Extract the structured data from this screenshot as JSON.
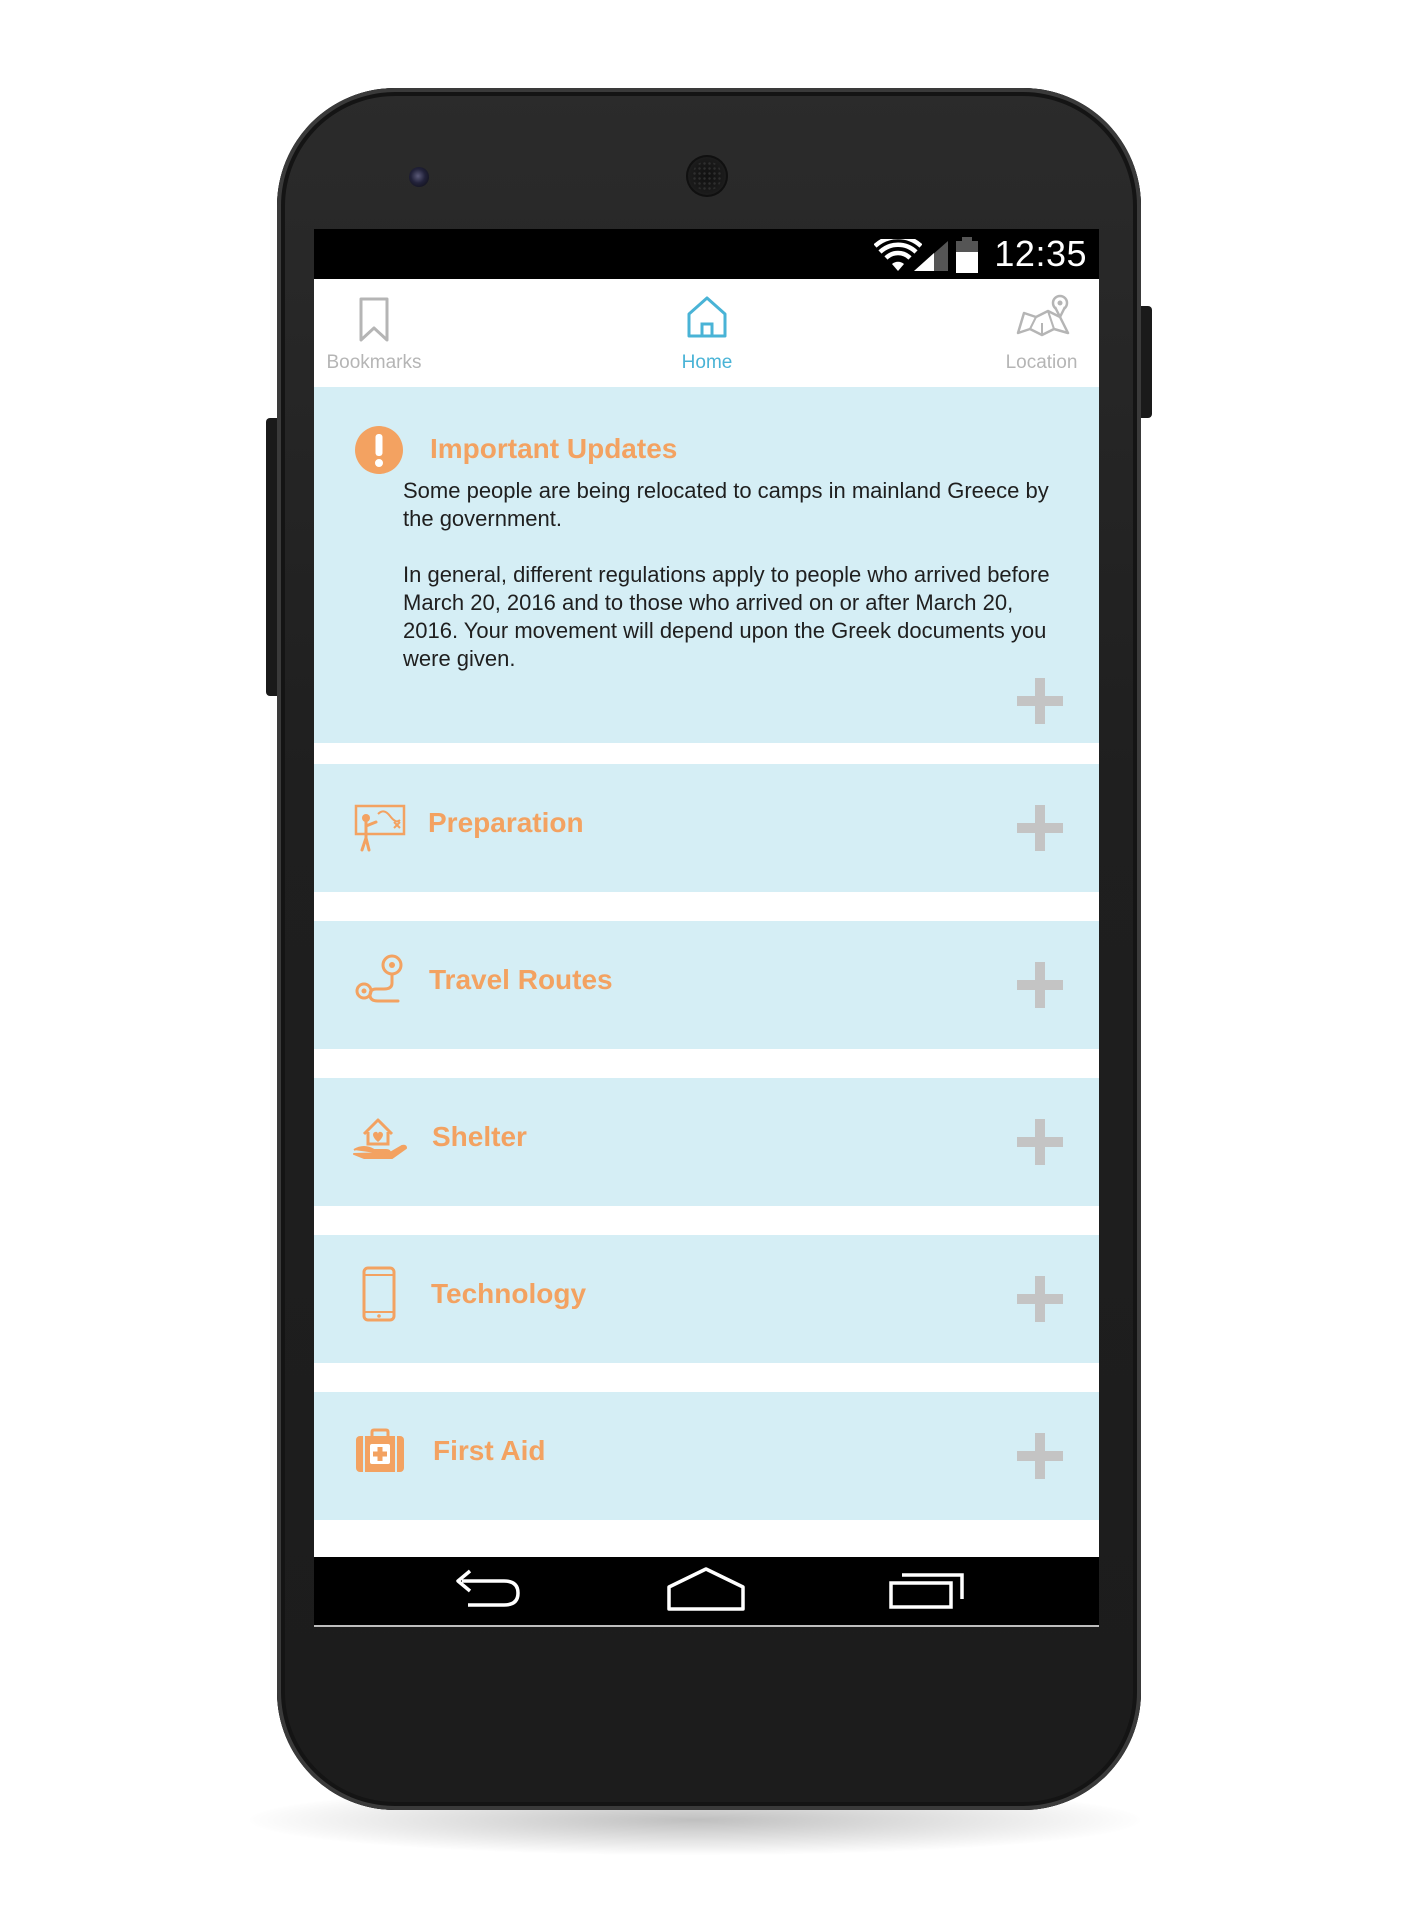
{
  "status_bar": {
    "time": "12:35",
    "icons": [
      "wifi-icon",
      "signal-icon",
      "battery-icon"
    ]
  },
  "top_nav": {
    "items": [
      {
        "label": "Bookmarks",
        "icon": "bookmark-icon",
        "active": false
      },
      {
        "label": "Home",
        "icon": "home-icon",
        "active": true
      },
      {
        "label": "Location",
        "icon": "map-pin-icon",
        "active": false
      }
    ]
  },
  "updates": {
    "title": "Important Updates",
    "icon": "exclamation-icon",
    "paragraphs": [
      "Some people are being relocated to camps in mainland Greece by the government.",
      "In general, different regulations apply to people who arrived before March 20, 2016 and to those who arrived on or after March 20, 2016. Your movement will depend upon the Greek documents you were given."
    ]
  },
  "sections": [
    {
      "title": "Preparation",
      "icon": "teacher-board-icon"
    },
    {
      "title": "Travel Routes",
      "icon": "route-icon"
    },
    {
      "title": "Shelter",
      "icon": "hand-house-icon"
    },
    {
      "title": "Technology",
      "icon": "smartphone-icon"
    },
    {
      "title": "First Aid",
      "icon": "first-aid-kit-icon"
    }
  ],
  "bottom_nav": {
    "icons": [
      "back-icon",
      "home-outline-icon",
      "recent-apps-icon"
    ]
  },
  "colors": {
    "accent_orange": "#f3a261",
    "active_blue": "#49b3d6",
    "inactive_gray": "#b5b5b5",
    "card_bg": "#d5eef5",
    "plus_gray": "#c4c4c4"
  }
}
